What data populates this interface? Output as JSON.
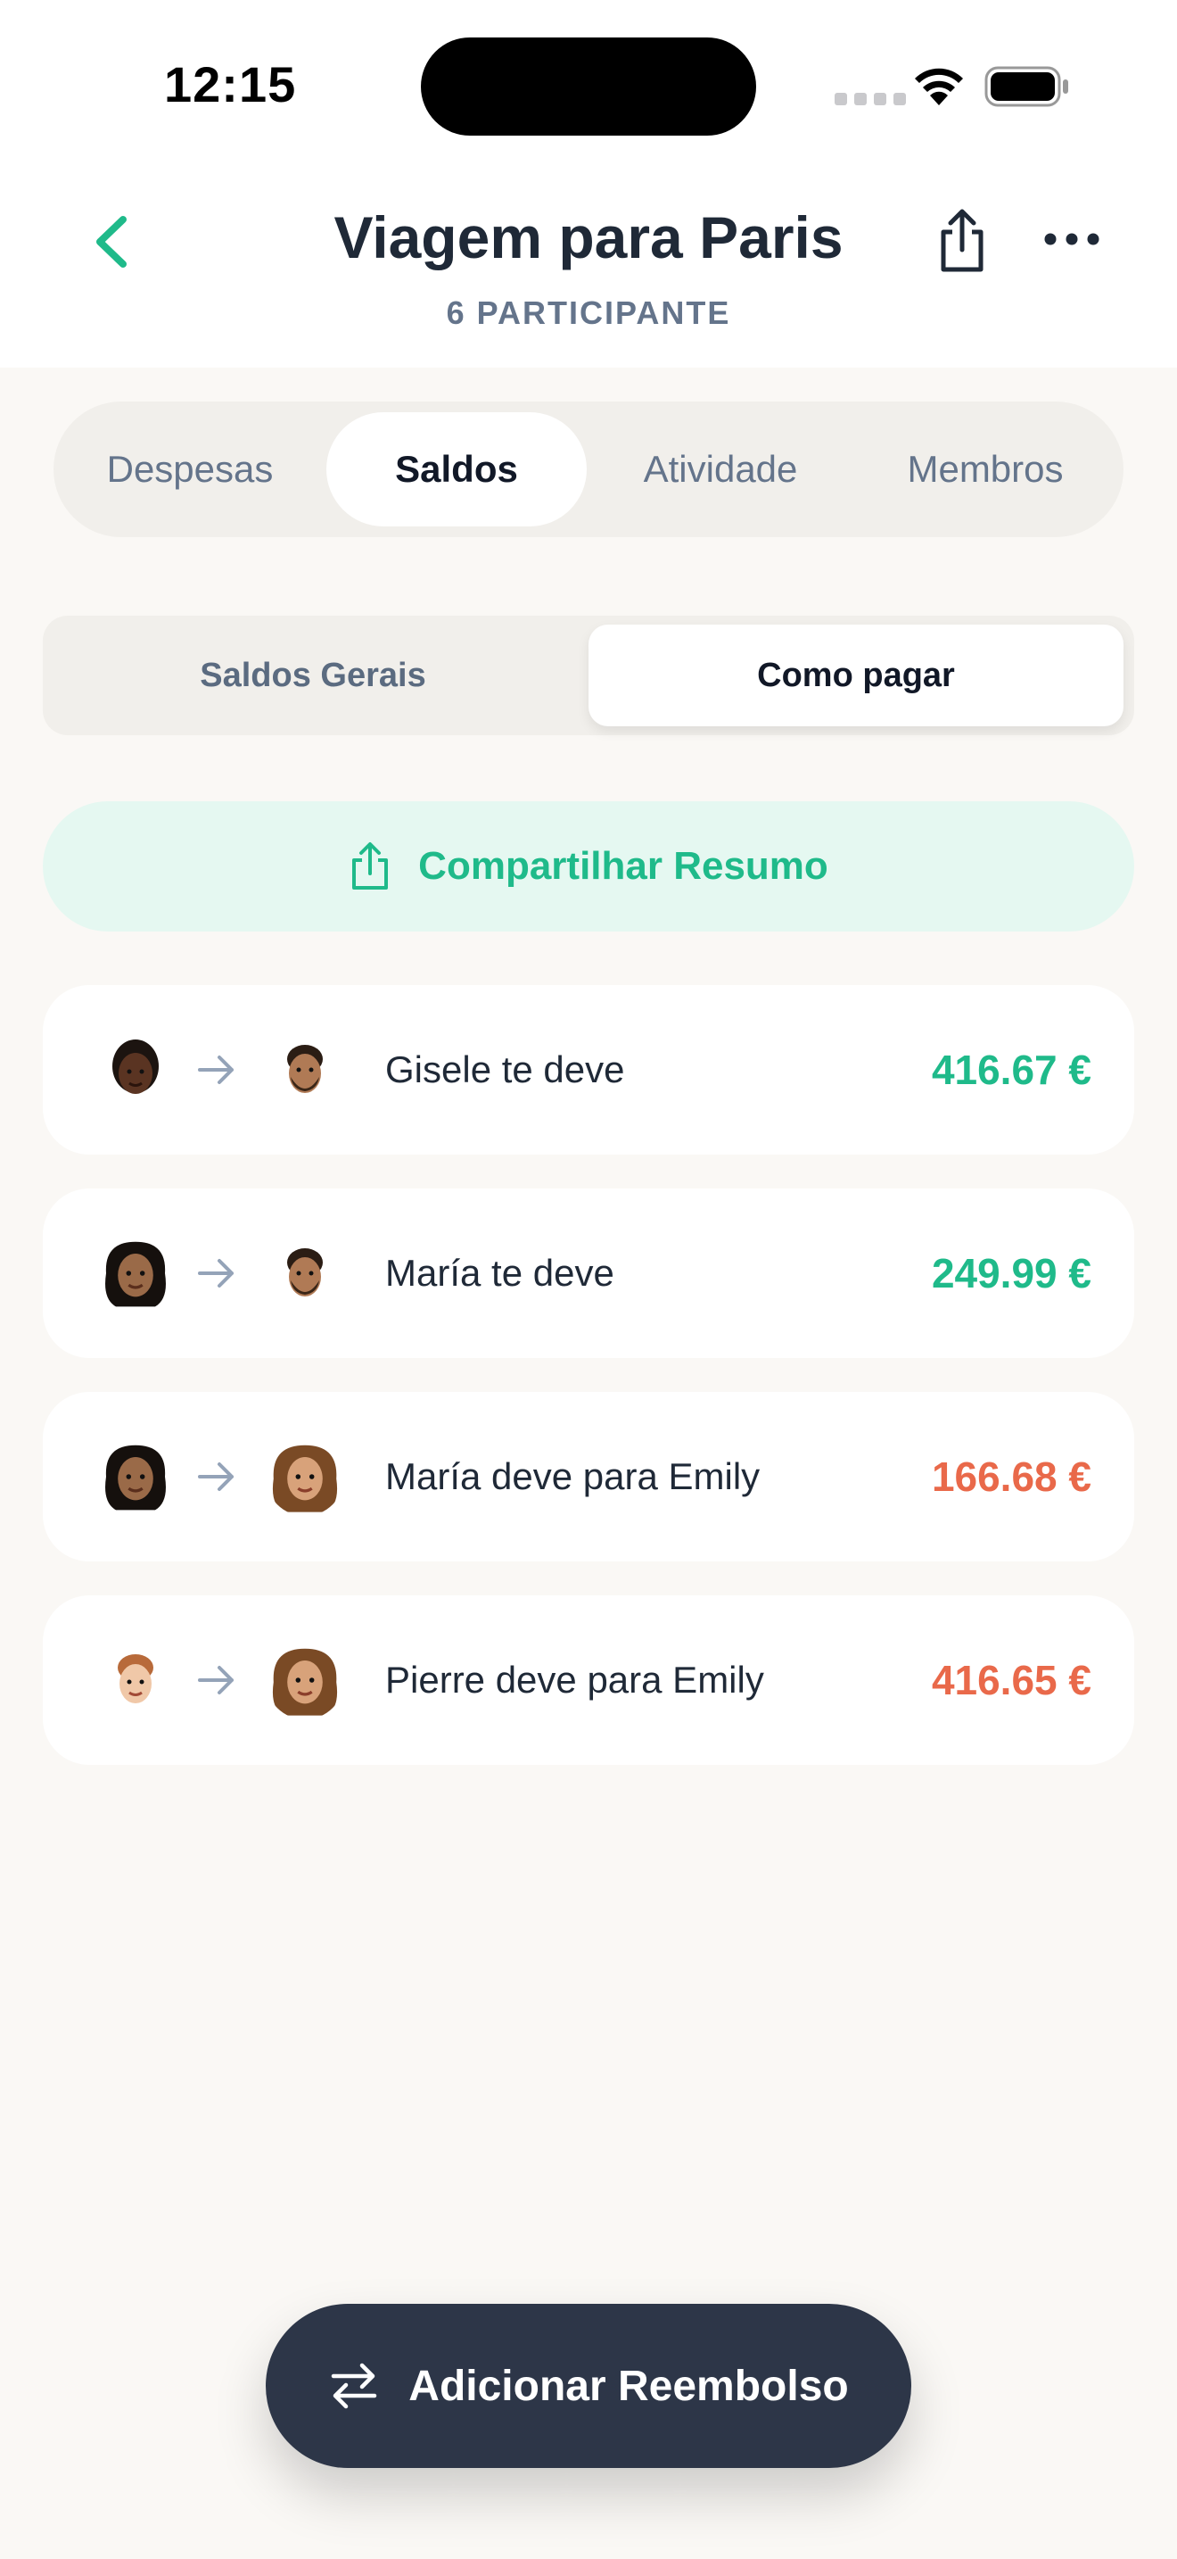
{
  "status_bar": {
    "time": "12:15"
  },
  "header": {
    "title": "Viagem para Paris",
    "subtitle": "6 PARTICIPANTE"
  },
  "tabs": [
    {
      "label": "Despesas",
      "active": false
    },
    {
      "label": "Saldos",
      "active": true
    },
    {
      "label": "Atividade",
      "active": false
    },
    {
      "label": "Membros",
      "active": false
    }
  ],
  "subtabs": [
    {
      "label": "Saldos Gerais",
      "active": false
    },
    {
      "label": "Como pagar",
      "active": true
    }
  ],
  "share_summary": {
    "label": "Compartilhar Resumo"
  },
  "settlements": [
    {
      "label": "Gisele te deve",
      "amount": "416.67 €",
      "kind": "positive"
    },
    {
      "label": "María te deve",
      "amount": "249.99 €",
      "kind": "positive"
    },
    {
      "label": "María deve para Emily",
      "amount": "166.68 €",
      "kind": "negative"
    },
    {
      "label": "Pierre deve para Emily",
      "amount": "416.65 €",
      "kind": "negative"
    }
  ],
  "fab": {
    "label": "Adicionar Reembolso"
  },
  "colors": {
    "accent": "#1fba8a",
    "negative": "#e9694a",
    "dark": "#2d3648"
  }
}
